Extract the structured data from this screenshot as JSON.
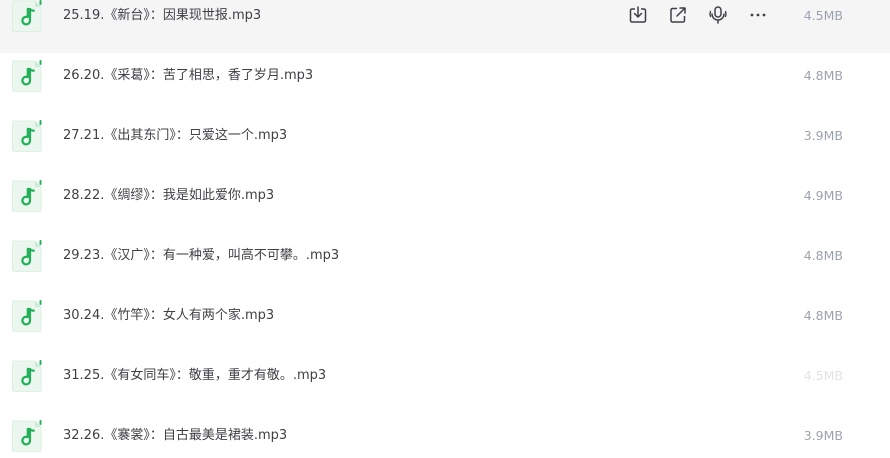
{
  "files": [
    {
      "name": "25.19.《新台》：因果现世报.mp3",
      "size": "4.5MB"
    },
    {
      "name": "26.20.《采葛》：苦了相思，香了岁月.mp3",
      "size": "4.8MB"
    },
    {
      "name": "27.21.《出其东门》：只爱这一个.mp3",
      "size": "3.9MB"
    },
    {
      "name": "28.22.《绸缪》：我是如此爱你.mp3",
      "size": "4.9MB"
    },
    {
      "name": "29.23.《汉广》：有一种爱，叫高不可攀。.mp3",
      "size": "4.8MB"
    },
    {
      "name": "30.24.《竹竿》：女人有两个家.mp3",
      "size": "4.8MB"
    },
    {
      "name": "31.25.《有女同车》：敬重，重才有敬。.mp3",
      "size": "4.5MB"
    },
    {
      "name": "32.26.《褰裳》：自古最美是裙装.mp3",
      "size": "3.9MB"
    }
  ],
  "hover_actions": {
    "icons": [
      "download-icon",
      "share-icon",
      "voice-icon",
      "more-icon"
    ]
  },
  "colors": {
    "accent": "#22b05a",
    "icon_bg": "#eaf6ee",
    "hover_bg": "#f5f5f6",
    "text": "#3f3f46",
    "size_text": "#9ca3af"
  }
}
